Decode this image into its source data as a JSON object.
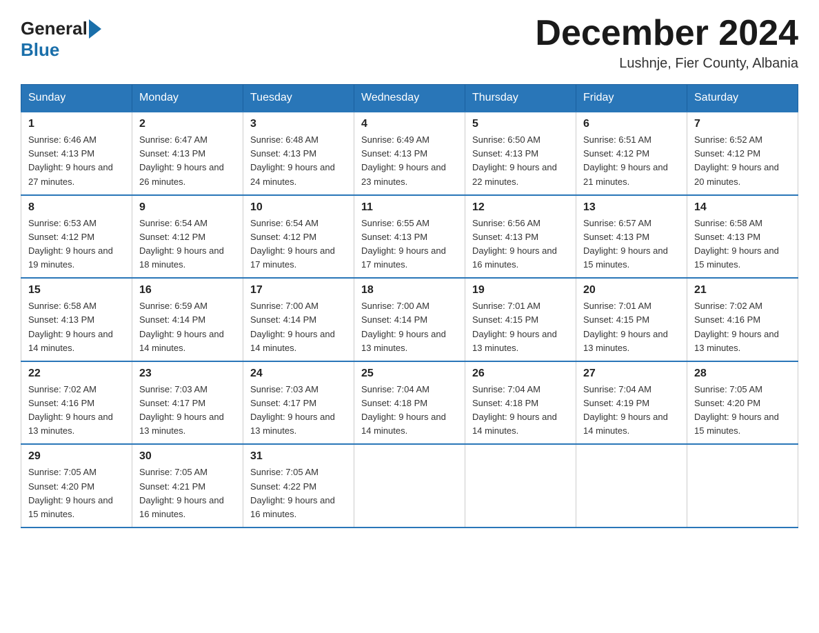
{
  "header": {
    "logo_general": "General",
    "logo_blue": "Blue",
    "month_year": "December 2024",
    "location": "Lushnje, Fier County, Albania"
  },
  "weekdays": [
    "Sunday",
    "Monday",
    "Tuesday",
    "Wednesday",
    "Thursday",
    "Friday",
    "Saturday"
  ],
  "weeks": [
    [
      {
        "day": "1",
        "sunrise": "Sunrise: 6:46 AM",
        "sunset": "Sunset: 4:13 PM",
        "daylight": "Daylight: 9 hours and 27 minutes."
      },
      {
        "day": "2",
        "sunrise": "Sunrise: 6:47 AM",
        "sunset": "Sunset: 4:13 PM",
        "daylight": "Daylight: 9 hours and 26 minutes."
      },
      {
        "day": "3",
        "sunrise": "Sunrise: 6:48 AM",
        "sunset": "Sunset: 4:13 PM",
        "daylight": "Daylight: 9 hours and 24 minutes."
      },
      {
        "day": "4",
        "sunrise": "Sunrise: 6:49 AM",
        "sunset": "Sunset: 4:13 PM",
        "daylight": "Daylight: 9 hours and 23 minutes."
      },
      {
        "day": "5",
        "sunrise": "Sunrise: 6:50 AM",
        "sunset": "Sunset: 4:13 PM",
        "daylight": "Daylight: 9 hours and 22 minutes."
      },
      {
        "day": "6",
        "sunrise": "Sunrise: 6:51 AM",
        "sunset": "Sunset: 4:12 PM",
        "daylight": "Daylight: 9 hours and 21 minutes."
      },
      {
        "day": "7",
        "sunrise": "Sunrise: 6:52 AM",
        "sunset": "Sunset: 4:12 PM",
        "daylight": "Daylight: 9 hours and 20 minutes."
      }
    ],
    [
      {
        "day": "8",
        "sunrise": "Sunrise: 6:53 AM",
        "sunset": "Sunset: 4:12 PM",
        "daylight": "Daylight: 9 hours and 19 minutes."
      },
      {
        "day": "9",
        "sunrise": "Sunrise: 6:54 AM",
        "sunset": "Sunset: 4:12 PM",
        "daylight": "Daylight: 9 hours and 18 minutes."
      },
      {
        "day": "10",
        "sunrise": "Sunrise: 6:54 AM",
        "sunset": "Sunset: 4:12 PM",
        "daylight": "Daylight: 9 hours and 17 minutes."
      },
      {
        "day": "11",
        "sunrise": "Sunrise: 6:55 AM",
        "sunset": "Sunset: 4:13 PM",
        "daylight": "Daylight: 9 hours and 17 minutes."
      },
      {
        "day": "12",
        "sunrise": "Sunrise: 6:56 AM",
        "sunset": "Sunset: 4:13 PM",
        "daylight": "Daylight: 9 hours and 16 minutes."
      },
      {
        "day": "13",
        "sunrise": "Sunrise: 6:57 AM",
        "sunset": "Sunset: 4:13 PM",
        "daylight": "Daylight: 9 hours and 15 minutes."
      },
      {
        "day": "14",
        "sunrise": "Sunrise: 6:58 AM",
        "sunset": "Sunset: 4:13 PM",
        "daylight": "Daylight: 9 hours and 15 minutes."
      }
    ],
    [
      {
        "day": "15",
        "sunrise": "Sunrise: 6:58 AM",
        "sunset": "Sunset: 4:13 PM",
        "daylight": "Daylight: 9 hours and 14 minutes."
      },
      {
        "day": "16",
        "sunrise": "Sunrise: 6:59 AM",
        "sunset": "Sunset: 4:14 PM",
        "daylight": "Daylight: 9 hours and 14 minutes."
      },
      {
        "day": "17",
        "sunrise": "Sunrise: 7:00 AM",
        "sunset": "Sunset: 4:14 PM",
        "daylight": "Daylight: 9 hours and 14 minutes."
      },
      {
        "day": "18",
        "sunrise": "Sunrise: 7:00 AM",
        "sunset": "Sunset: 4:14 PM",
        "daylight": "Daylight: 9 hours and 13 minutes."
      },
      {
        "day": "19",
        "sunrise": "Sunrise: 7:01 AM",
        "sunset": "Sunset: 4:15 PM",
        "daylight": "Daylight: 9 hours and 13 minutes."
      },
      {
        "day": "20",
        "sunrise": "Sunrise: 7:01 AM",
        "sunset": "Sunset: 4:15 PM",
        "daylight": "Daylight: 9 hours and 13 minutes."
      },
      {
        "day": "21",
        "sunrise": "Sunrise: 7:02 AM",
        "sunset": "Sunset: 4:16 PM",
        "daylight": "Daylight: 9 hours and 13 minutes."
      }
    ],
    [
      {
        "day": "22",
        "sunrise": "Sunrise: 7:02 AM",
        "sunset": "Sunset: 4:16 PM",
        "daylight": "Daylight: 9 hours and 13 minutes."
      },
      {
        "day": "23",
        "sunrise": "Sunrise: 7:03 AM",
        "sunset": "Sunset: 4:17 PM",
        "daylight": "Daylight: 9 hours and 13 minutes."
      },
      {
        "day": "24",
        "sunrise": "Sunrise: 7:03 AM",
        "sunset": "Sunset: 4:17 PM",
        "daylight": "Daylight: 9 hours and 13 minutes."
      },
      {
        "day": "25",
        "sunrise": "Sunrise: 7:04 AM",
        "sunset": "Sunset: 4:18 PM",
        "daylight": "Daylight: 9 hours and 14 minutes."
      },
      {
        "day": "26",
        "sunrise": "Sunrise: 7:04 AM",
        "sunset": "Sunset: 4:18 PM",
        "daylight": "Daylight: 9 hours and 14 minutes."
      },
      {
        "day": "27",
        "sunrise": "Sunrise: 7:04 AM",
        "sunset": "Sunset: 4:19 PM",
        "daylight": "Daylight: 9 hours and 14 minutes."
      },
      {
        "day": "28",
        "sunrise": "Sunrise: 7:05 AM",
        "sunset": "Sunset: 4:20 PM",
        "daylight": "Daylight: 9 hours and 15 minutes."
      }
    ],
    [
      {
        "day": "29",
        "sunrise": "Sunrise: 7:05 AM",
        "sunset": "Sunset: 4:20 PM",
        "daylight": "Daylight: 9 hours and 15 minutes."
      },
      {
        "day": "30",
        "sunrise": "Sunrise: 7:05 AM",
        "sunset": "Sunset: 4:21 PM",
        "daylight": "Daylight: 9 hours and 16 minutes."
      },
      {
        "day": "31",
        "sunrise": "Sunrise: 7:05 AM",
        "sunset": "Sunset: 4:22 PM",
        "daylight": "Daylight: 9 hours and 16 minutes."
      },
      null,
      null,
      null,
      null
    ]
  ]
}
